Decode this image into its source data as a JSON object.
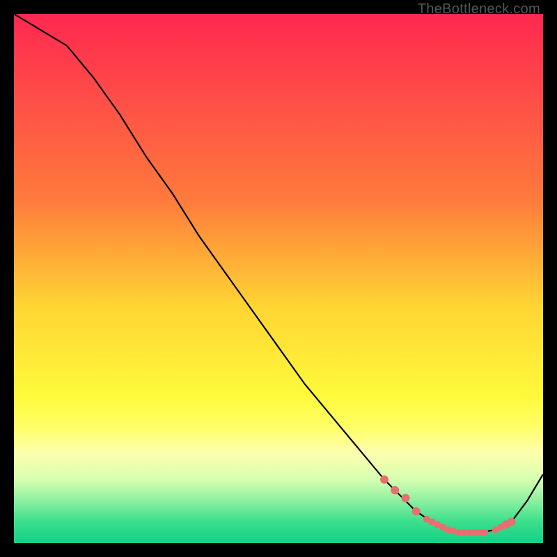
{
  "watermark": "TheBottleneck.com",
  "chart_data": {
    "type": "line",
    "title": "",
    "xlabel": "",
    "ylabel": "",
    "xlim": [
      0,
      100
    ],
    "ylim": [
      0,
      100
    ],
    "series": [
      {
        "name": "curve",
        "x": [
          0,
          5,
          10,
          15,
          20,
          25,
          30,
          35,
          40,
          45,
          50,
          55,
          60,
          65,
          70,
          73,
          76,
          79,
          82,
          85,
          88,
          91,
          94,
          97,
          100
        ],
        "y": [
          100,
          97,
          94,
          88,
          81,
          73,
          66,
          58,
          51,
          44,
          37,
          30,
          24,
          18,
          12,
          9,
          6,
          4,
          2.5,
          2,
          2,
          2.5,
          4,
          8,
          13
        ]
      }
    ],
    "highlight_points": {
      "name": "dots",
      "x": [
        70,
        72,
        74,
        76,
        78,
        79,
        80,
        81,
        82,
        83,
        84,
        85,
        86,
        87,
        88,
        89,
        91,
        92,
        93,
        94
      ],
      "y": [
        12,
        10,
        8.5,
        6,
        4.5,
        4,
        3.5,
        3,
        2.5,
        2.3,
        2,
        2,
        2,
        2,
        2,
        2,
        2.5,
        3,
        3.5,
        4
      ]
    },
    "gradient_stops": [
      {
        "offset": 0.0,
        "color": "#ff2850"
      },
      {
        "offset": 0.35,
        "color": "#ff7a3c"
      },
      {
        "offset": 0.55,
        "color": "#ffd433"
      },
      {
        "offset": 0.72,
        "color": "#fff93a"
      },
      {
        "offset": 0.78,
        "color": "#ffff66"
      },
      {
        "offset": 0.83,
        "color": "#fdffae"
      },
      {
        "offset": 0.88,
        "color": "#d6ffb0"
      },
      {
        "offset": 0.92,
        "color": "#8cf0a0"
      },
      {
        "offset": 0.96,
        "color": "#3adf8c"
      },
      {
        "offset": 1.0,
        "color": "#14cf86"
      }
    ],
    "dot_color": "#e76f6f",
    "line_color": "#000000"
  }
}
